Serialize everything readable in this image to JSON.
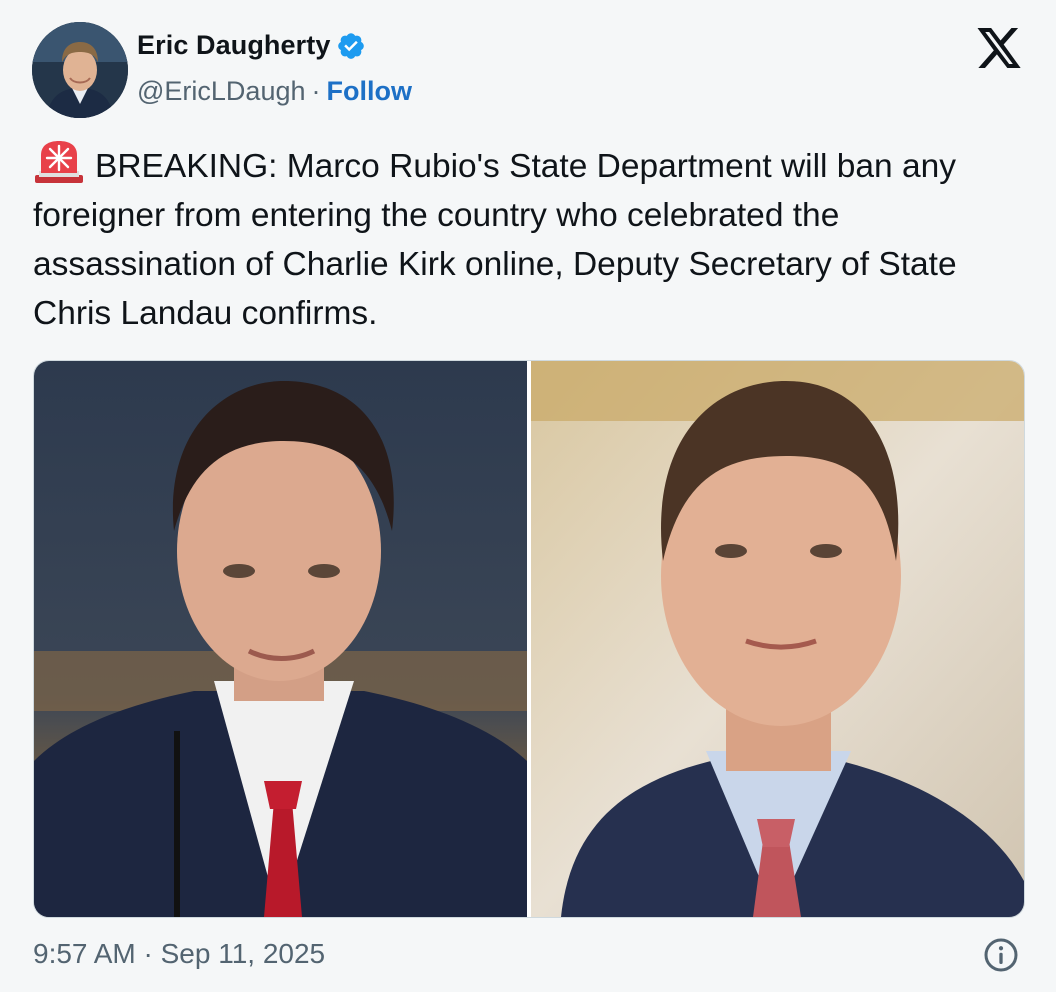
{
  "author": {
    "name": "Eric Daugherty",
    "handle": "@EricLDaugh",
    "separator": "·",
    "follow_label": "Follow",
    "verified": true,
    "avatar_icon": "avatar"
  },
  "tweet": {
    "emoji_icon": "siren-icon",
    "text": "BREAKING: Marco Rubio's State Department will ban any foreigner from entering the country who celebrated the assassination of Charlie Kirk online, Deputy Secretary of State Chris Landau confirms."
  },
  "footer": {
    "timestamp": "9:57 AM · Sep 11, 2025"
  },
  "colors": {
    "follow": "#1d70c6",
    "verified_badge": "#1d9bf0",
    "secondary_text": "#536471"
  }
}
